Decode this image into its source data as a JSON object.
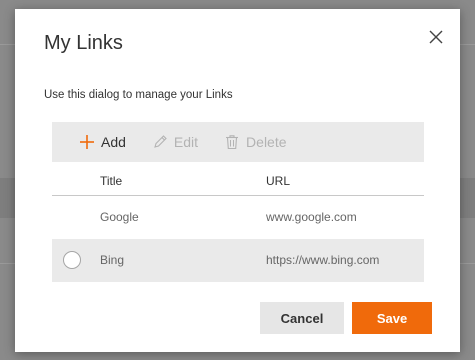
{
  "dialog": {
    "title": "My Links",
    "description": "Use this dialog to manage your Links",
    "close_icon": "close-icon"
  },
  "toolbar": {
    "add_label": "Add",
    "edit_label": "Edit",
    "delete_label": "Delete",
    "icons": [
      "plus-icon",
      "pencil-icon",
      "trash-icon"
    ]
  },
  "table": {
    "headers": {
      "title": "Title",
      "url": "URL"
    },
    "rows": [
      {
        "title": "Google",
        "url": "www.google.com",
        "selected": false
      },
      {
        "title": "Bing",
        "url": "https://www.bing.com",
        "selected": false
      }
    ]
  },
  "footer": {
    "cancel_label": "Cancel",
    "save_label": "Save"
  },
  "colors": {
    "accent": "#f06a0b",
    "toolbar_bg": "#eaeaea",
    "overlay": "#8a8a8a"
  }
}
